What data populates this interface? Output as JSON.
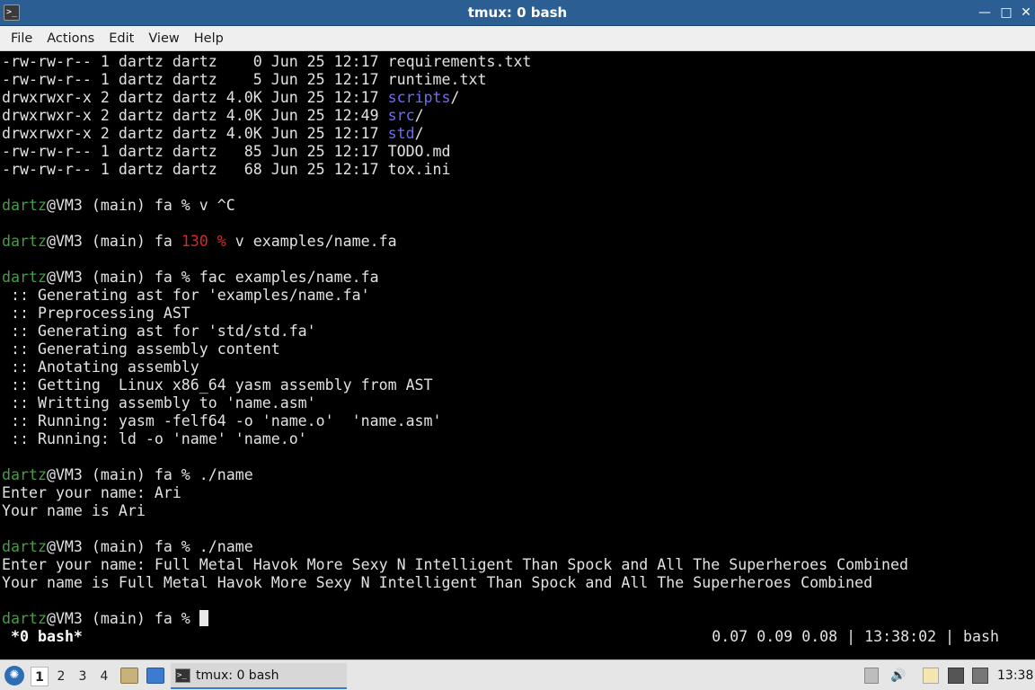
{
  "window": {
    "title": "tmux: 0 bash",
    "min_glyph": "—",
    "max_glyph": "□",
    "close_glyph": "✕",
    "app_icon": "terminal-icon",
    "app_icon_glyph": ">_"
  },
  "menu": [
    "File",
    "Actions",
    "Edit",
    "View",
    "Help"
  ],
  "terminal": {
    "lines": [
      {
        "text": "-rw-rw-r-- 1 dartz dartz    0 Jun 25 12:17 requirements.txt"
      },
      {
        "text": "-rw-rw-r-- 1 dartz dartz    5 Jun 25 12:17 runtime.txt"
      },
      {
        "text": "drwxrwxr-x 2 dartz dartz 4.0K Jun 25 12:17 ",
        "dir": "scripts",
        "tail": "/"
      },
      {
        "text": "drwxrwxr-x 2 dartz dartz 4.0K Jun 25 12:49 ",
        "dir": "src",
        "tail": "/"
      },
      {
        "text": "drwxrwxr-x 2 dartz dartz 4.0K Jun 25 12:17 ",
        "dir": "std",
        "tail": "/"
      },
      {
        "text": "-rw-rw-r-- 1 dartz dartz   85 Jun 25 12:17 TODO.md"
      },
      {
        "text": "-rw-rw-r-- 1 dartz dartz   68 Jun 25 12:17 tox.ini"
      },
      {
        "text": ""
      },
      {
        "user": "dartz",
        "text": "@VM3 (main) fa % v ^C"
      },
      {
        "text": ""
      },
      {
        "user": "dartz",
        "text": "@VM3 (main) fa ",
        "code": "130 %",
        "tail": " v examples/name.fa"
      },
      {
        "text": ""
      },
      {
        "user": "dartz",
        "text": "@VM3 (main) fa % fac examples/name.fa"
      },
      {
        "text": " :: Generating ast for 'examples/name.fa'"
      },
      {
        "text": " :: Preprocessing AST"
      },
      {
        "text": " :: Generating ast for 'std/std.fa'"
      },
      {
        "text": " :: Generating assembly content"
      },
      {
        "text": " :: Anotating assembly"
      },
      {
        "text": " :: Getting  Linux x86_64 yasm assembly from AST"
      },
      {
        "text": " :: Writting assembly to 'name.asm'"
      },
      {
        "text": " :: Running: yasm -felf64 -o 'name.o'  'name.asm'"
      },
      {
        "text": " :: Running: ld -o 'name' 'name.o'"
      },
      {
        "text": ""
      },
      {
        "user": "dartz",
        "text": "@VM3 (main) fa % ./name"
      },
      {
        "text": "Enter your name: Ari"
      },
      {
        "text": "Your name is Ari"
      },
      {
        "text": ""
      },
      {
        "user": "dartz",
        "text": "@VM3 (main) fa % ./name"
      },
      {
        "text": "Enter your name: Full Metal Havok More Sexy N Intelligent Than Spock and All The Superheroes Combined"
      },
      {
        "text": "Your name is Full Metal Havok More Sexy N Intelligent Than Spock and All The Superheroes Combined"
      },
      {
        "text": ""
      },
      {
        "user": "dartz",
        "text": "@VM3 (main) fa % ",
        "cursor": true
      }
    ],
    "status_left": "*0 bash*",
    "status_right": "0.07 0.09 0.08 | 13:38:02 | bash"
  },
  "taskbar": {
    "workspaces": [
      "1",
      "2",
      "3",
      "4"
    ],
    "active_workspace": "1",
    "task_label": "tmux: 0 bash",
    "clock": "13:38",
    "icons": [
      "start-menu-icon",
      "file-manager-icon",
      "show-desktop-icon",
      "volume-icon",
      "clipboard-icon",
      "network-icon",
      "battery-icon"
    ]
  },
  "colors": {
    "titlebar": "#2b5f93",
    "prompt_user": "#40a040",
    "directory": "#6b6bff",
    "exit_code": "#d22a2a"
  }
}
